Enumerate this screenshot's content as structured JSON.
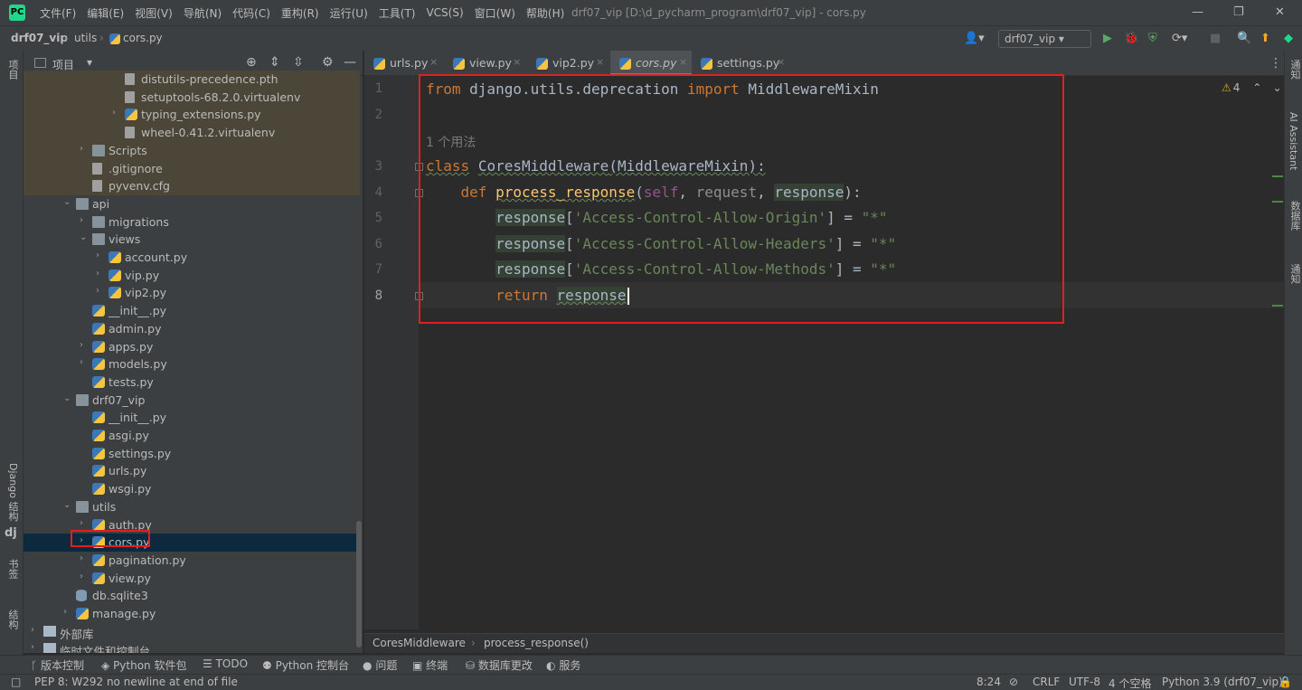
{
  "menubar": {
    "items": [
      "文件(F)",
      "编辑(E)",
      "视图(V)",
      "导航(N)",
      "代码(C)",
      "重构(R)",
      "运行(U)",
      "工具(T)",
      "VCS(S)",
      "窗口(W)",
      "帮助(H)"
    ],
    "title": "drf07_vip [D:\\d_pycharm_program\\drf07_vip] - cors.py",
    "logo": "PC",
    "minimize": "—",
    "maximize": "❐",
    "close": "✕"
  },
  "navbar": {
    "crumbs": [
      "drf07_vip",
      "utils",
      "cors.py"
    ],
    "run_config": "drf07_vip ▾",
    "user_icon": "👤▾",
    "run_icon": "▶",
    "debug_icon": "🐞",
    "coverage_icon": "⛨",
    "profile_icon": "⟳▾",
    "stop_icon": "■",
    "search_icon": "🔍",
    "update_icon": "⬆",
    "logo_icon": "◆"
  },
  "left_strip": {
    "project": "项目",
    "django": "Django 结构",
    "django_icon": "dj",
    "bookmarks": "书签",
    "structure": "结构"
  },
  "right_strip": {
    "db": "数据库",
    "ai": "AI Assistant",
    "notify": "通知"
  },
  "project_panel": {
    "title": "项目",
    "dropdown": "▾",
    "locate_icon": "⊕",
    "expand_icon": "⇕",
    "collapse_icon": "⇳",
    "gear_icon": "⚙",
    "hide_icon": "—",
    "tree": [
      {
        "label": "distutils-precedence.pth",
        "depth": 5,
        "type": "file",
        "arrow": "",
        "venv": true
      },
      {
        "label": "setuptools-68.2.0.virtualenv",
        "depth": 5,
        "type": "file",
        "arrow": "",
        "venv": true
      },
      {
        "label": "typing_extensions.py",
        "depth": 5,
        "type": "py",
        "arrow": "›",
        "venv": true
      },
      {
        "label": "wheel-0.41.2.virtualenv",
        "depth": 5,
        "type": "file",
        "arrow": "",
        "venv": true
      },
      {
        "label": "Scripts",
        "depth": 3,
        "type": "folder",
        "arrow": "›",
        "venv": true
      },
      {
        "label": ".gitignore",
        "depth": 3,
        "type": "file",
        "arrow": "",
        "venv": true
      },
      {
        "label": "pyvenv.cfg",
        "depth": 3,
        "type": "file",
        "arrow": "",
        "venv": true
      },
      {
        "label": "api",
        "depth": 2,
        "type": "pkg",
        "arrow": "⌄",
        "venv": false
      },
      {
        "label": "migrations",
        "depth": 3,
        "type": "pkg",
        "arrow": "›",
        "venv": false
      },
      {
        "label": "views",
        "depth": 3,
        "type": "folder",
        "arrow": "⌄",
        "venv": false
      },
      {
        "label": "account.py",
        "depth": 4,
        "type": "py",
        "arrow": "›",
        "venv": false
      },
      {
        "label": "vip.py",
        "depth": 4,
        "type": "py",
        "arrow": "›",
        "venv": false
      },
      {
        "label": "vip2.py",
        "depth": 4,
        "type": "py",
        "arrow": "›",
        "venv": false
      },
      {
        "label": "__init__.py",
        "depth": 3,
        "type": "py",
        "arrow": "",
        "venv": false
      },
      {
        "label": "admin.py",
        "depth": 3,
        "type": "py",
        "arrow": "",
        "venv": false
      },
      {
        "label": "apps.py",
        "depth": 3,
        "type": "py",
        "arrow": "›",
        "venv": false
      },
      {
        "label": "models.py",
        "depth": 3,
        "type": "py",
        "arrow": "›",
        "venv": false
      },
      {
        "label": "tests.py",
        "depth": 3,
        "type": "py",
        "arrow": "",
        "venv": false
      },
      {
        "label": "drf07_vip",
        "depth": 2,
        "type": "pkg",
        "arrow": "⌄",
        "venv": false
      },
      {
        "label": "__init__.py",
        "depth": 3,
        "type": "py",
        "arrow": "",
        "venv": false
      },
      {
        "label": "asgi.py",
        "depth": 3,
        "type": "py",
        "arrow": "",
        "venv": false
      },
      {
        "label": "settings.py",
        "depth": 3,
        "type": "py",
        "arrow": "",
        "venv": false
      },
      {
        "label": "urls.py",
        "depth": 3,
        "type": "py",
        "arrow": "",
        "venv": false
      },
      {
        "label": "wsgi.py",
        "depth": 3,
        "type": "py",
        "arrow": "",
        "venv": false
      },
      {
        "label": "utils",
        "depth": 2,
        "type": "folder",
        "arrow": "⌄",
        "venv": false
      },
      {
        "label": "auth.py",
        "depth": 3,
        "type": "py",
        "arrow": "›",
        "venv": false
      },
      {
        "label": "cors.py",
        "depth": 3,
        "type": "py",
        "arrow": "›",
        "venv": false,
        "selected": true
      },
      {
        "label": "pagination.py",
        "depth": 3,
        "type": "py",
        "arrow": "›",
        "venv": false
      },
      {
        "label": "view.py",
        "depth": 3,
        "type": "py",
        "arrow": "›",
        "venv": false
      },
      {
        "label": "db.sqlite3",
        "depth": 2,
        "type": "db",
        "arrow": "",
        "venv": false
      },
      {
        "label": "manage.py",
        "depth": 2,
        "type": "py",
        "arrow": "›",
        "venv": false
      },
      {
        "label": "外部库",
        "depth": 0,
        "type": "lib",
        "arrow": "›",
        "venv": false
      },
      {
        "label": "临时文件和控制台",
        "depth": 0,
        "type": "lib",
        "arrow": "›",
        "venv": false
      }
    ]
  },
  "tabs": [
    {
      "label": "urls.py",
      "active": false
    },
    {
      "label": "view.py",
      "active": false
    },
    {
      "label": "vip2.py",
      "active": false
    },
    {
      "label": "cors.py",
      "active": true
    },
    {
      "label": "settings.py",
      "active": false
    }
  ],
  "tab_close": "×",
  "tab_menu": "⋮",
  "editor": {
    "line_numbers": [
      "1",
      "2",
      "3",
      "4",
      "5",
      "6",
      "7",
      "8"
    ],
    "usage_hint": "1 个用法",
    "line1": {
      "from": "from",
      "module": " django.utils.deprecation ",
      "import": "import",
      "name": " MiddlewareMixin"
    },
    "line3": {
      "class": "class",
      "name": "CoresMiddleware",
      "base": "(MiddlewareMixin):"
    },
    "line4": {
      "def": "def",
      "fn": "process_response",
      "open": "(",
      "self": "self",
      "comma1": ", ",
      "request": "request",
      "comma2": ", ",
      "response": "response",
      "close": "):"
    },
    "line5": {
      "var": "response",
      "lb": "[",
      "key": "'Access-Control-Allow-Origin'",
      "rb": "] = ",
      "val": "\"*\""
    },
    "line6": {
      "var": "response",
      "lb": "[",
      "key": "'Access-Control-Allow-Headers'",
      "rb": "] = ",
      "val": "\"*\""
    },
    "line7": {
      "var": "response",
      "lb": "[",
      "key": "'Access-Control-Allow-Methods'",
      "rb": "] = ",
      "val": "\"*\""
    },
    "line8": {
      "return": "return",
      "var": "response"
    },
    "warnings": "4",
    "warn_icon": "⚠",
    "up": "⌃",
    "down": "⌄"
  },
  "breadcrumb_bar": {
    "items": [
      "CoresMiddleware",
      "process_response()"
    ]
  },
  "tool_windows": [
    {
      "icon": "ᚴ",
      "label": "版本控制"
    },
    {
      "icon": "◈",
      "label": "Python 软件包"
    },
    {
      "icon": "☰",
      "label": "TODO"
    },
    {
      "icon": "⚉",
      "label": "Python 控制台"
    },
    {
      "icon": "●",
      "label": "问题"
    },
    {
      "icon": "▣",
      "label": "终端"
    },
    {
      "icon": "⛁",
      "label": "数据库更改"
    },
    {
      "icon": "◐",
      "label": "服务"
    }
  ],
  "status": {
    "message": "PEP 8: W292 no newline at end of file",
    "status_icon": "□",
    "position": "8:24",
    "readonly_icon": "⊘",
    "line_sep": "CRLF",
    "encoding": "UTF-8",
    "indent": "4 个空格",
    "interpreter": "Python 3.9 (drf07_vip)",
    "lock_icon": "🔒"
  }
}
